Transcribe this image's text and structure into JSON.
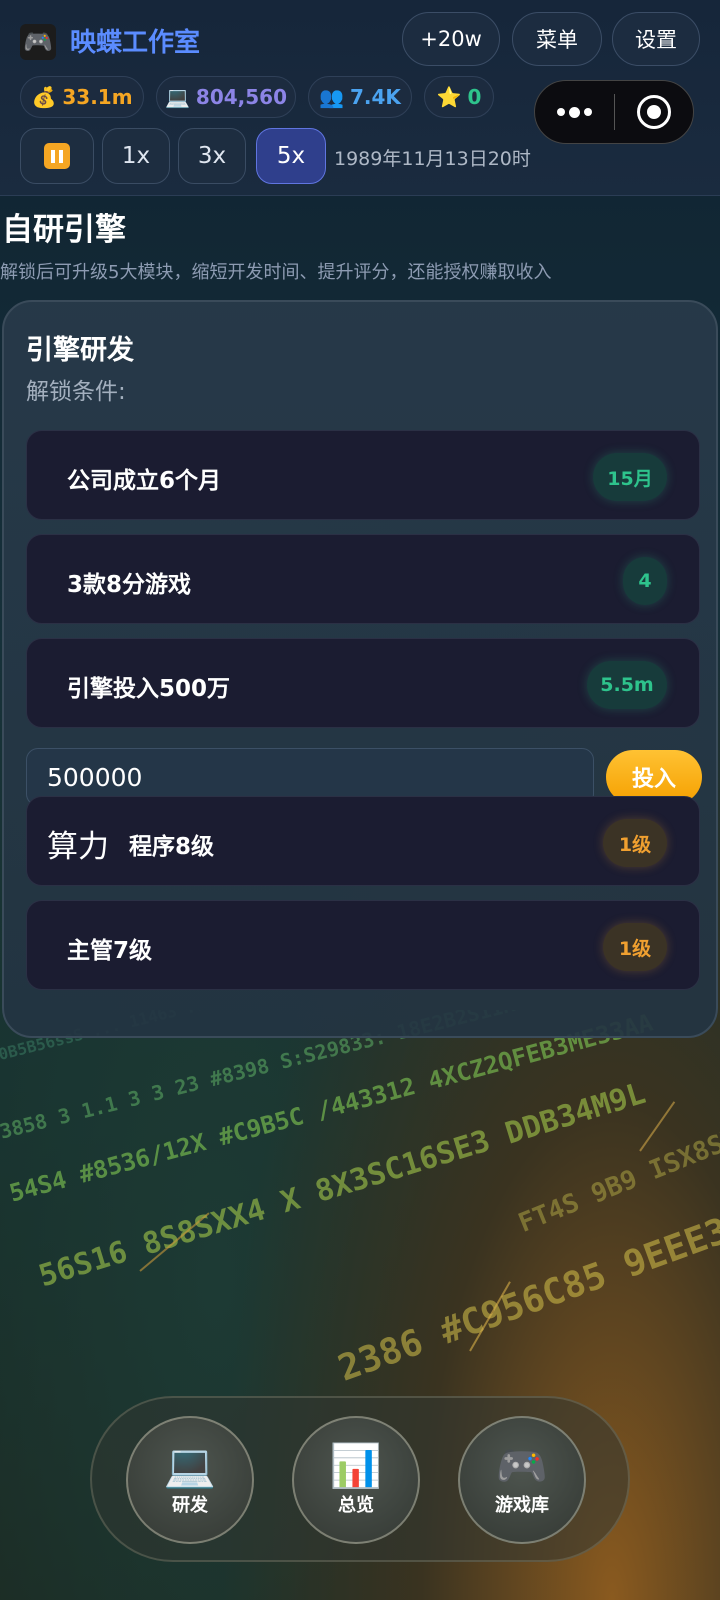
{
  "header": {
    "studio_name": "映蝶工作室",
    "logo_icon": "gamepad-icon",
    "buttons": {
      "bonus": "+20w",
      "menu": "菜单",
      "settings": "设置"
    },
    "stats": {
      "money": {
        "icon": "💰",
        "value": "33.1m",
        "color": "#f5a623"
      },
      "compute": {
        "icon": "💻",
        "value": "804,560",
        "color": "#8c84e6"
      },
      "fans": {
        "icon": "👥",
        "value": "7.4K",
        "color": "#4ba3f0"
      },
      "stars": {
        "icon": "⭐",
        "value": "0",
        "color": "#2ec38c"
      }
    },
    "speed": {
      "options": [
        "1x",
        "3x",
        "5x"
      ],
      "active": "5x"
    },
    "date": "1989年11月13日20时"
  },
  "section": {
    "title": "自研引擎",
    "description": "解锁后可升级5大模块，缩短开发时间、提升评分，还能授权赚取收入"
  },
  "panel": {
    "title": "引擎研发",
    "subtitle": "解锁条件:",
    "conditions": [
      {
        "label": "公司成立6个月",
        "badge": "15月"
      },
      {
        "label": "3款8分游戏",
        "badge": "4"
      },
      {
        "label": "引擎投入500万",
        "badge": "5.5m"
      }
    ],
    "invest": {
      "value": "500000",
      "button": "投入"
    },
    "requirements": [
      {
        "prefix": "算力",
        "label": "程序8级",
        "badge": "1级"
      },
      {
        "label": "主管7级",
        "badge": "1级"
      }
    ]
  },
  "bottom_nav": [
    {
      "icon": "💻",
      "label": "研发"
    },
    {
      "icon": "📊",
      "label": "总览"
    },
    {
      "icon": "🎮",
      "label": "游戏库"
    }
  ],
  "colors": {
    "accent_blue": "#5b8cff",
    "success_green": "#2ec38c",
    "warning_orange": "#f0a030",
    "invest_button": "#f5a623"
  }
}
